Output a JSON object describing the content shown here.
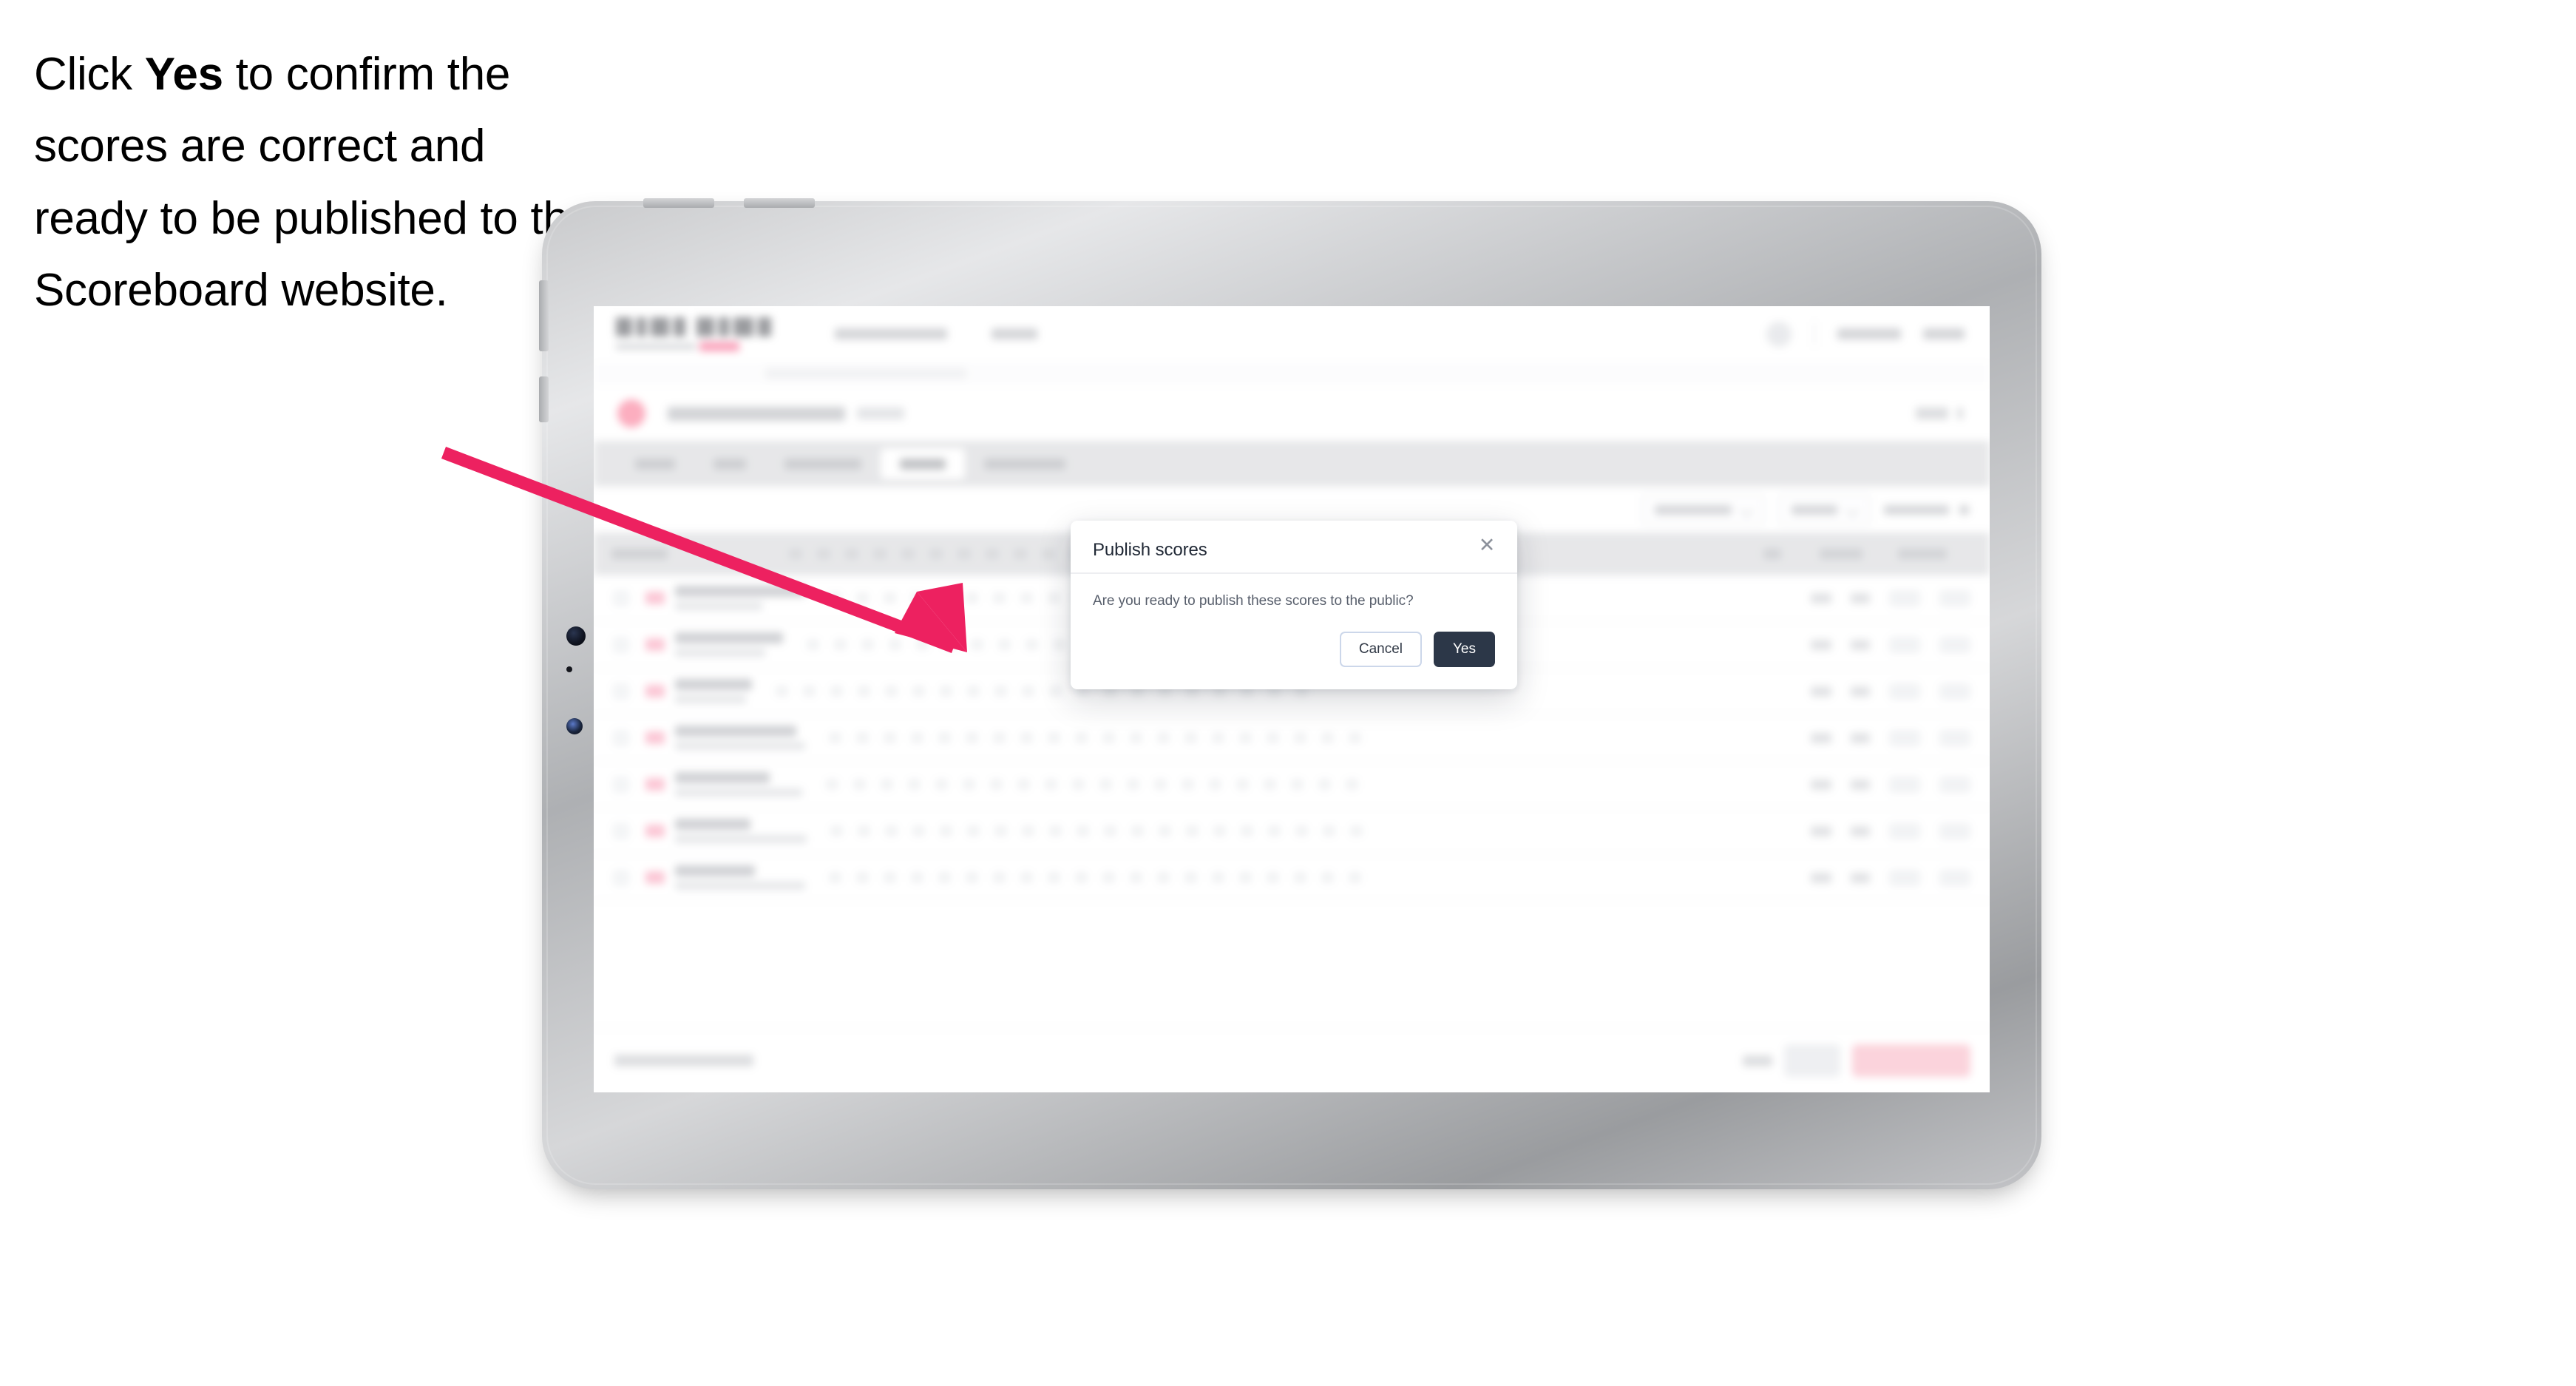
{
  "annotation": {
    "text_parts": [
      {
        "text": "Click ",
        "bold": false
      },
      {
        "text": "Yes",
        "bold": true
      },
      {
        "text": " to confirm the scores are correct and ready to be published to the Scoreboard website.",
        "bold": false
      }
    ],
    "full_text": "Click Yes to confirm the scores are correct and ready to be published to the Scoreboard website.",
    "arrow_color": "#ED2160",
    "arrow_direction": "down-right"
  },
  "device": {
    "type": "tablet",
    "bezel_color": "#0c0c0d",
    "rim_color": "#c9cacc"
  },
  "modal": {
    "title": "Publish scores",
    "close_icon": "close-icon",
    "body": "Are you ready to publish these scores to the public?",
    "cancel_label": "Cancel",
    "confirm_label": "Yes",
    "confirm_bg": "#2c3748",
    "cancel_border": "#ccd7ea"
  },
  "background_app": {
    "blurred": true,
    "brand_accent": "#f4386e",
    "tabbar_bg": "#d8d9dc",
    "active_tab_index": 3,
    "tab_count": 5,
    "nav_link_count": 2,
    "filter_control_count": 3,
    "table": {
      "row_count": 7,
      "score_column_count": 20,
      "has_checkbox_column": true,
      "has_flag_icons": true,
      "header_bg": "#d8d9dc"
    },
    "footer": {
      "primary_button_color": "#f9b8c6",
      "secondary_button_color": "#e4e6ea"
    }
  }
}
